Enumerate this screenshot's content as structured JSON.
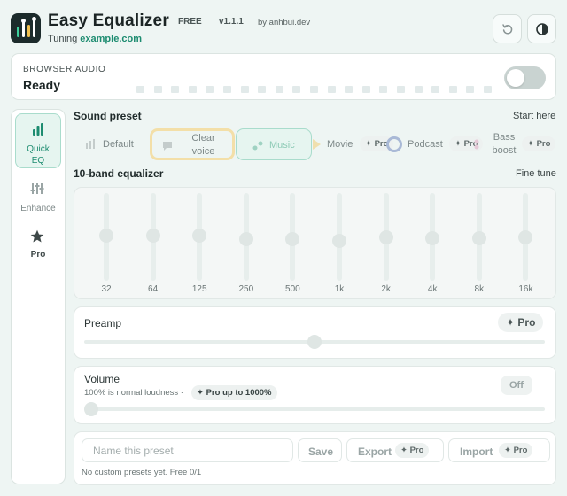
{
  "header": {
    "title": "Easy Equalizer",
    "badge": "FREE",
    "version": "v1.1.1",
    "author": "by anhbui.dev",
    "tuning_label": "Tuning",
    "tuning_domain": "example.com",
    "reset_icon": "reset-icon",
    "theme_icon": "contrast-icon"
  },
  "status": {
    "eyebrow": "BROWSER AUDIO",
    "value": "Ready",
    "enabled": false,
    "meter_level": 0
  },
  "sidebar": {
    "items": [
      {
        "label_line1": "Quick",
        "label_line2": "EQ",
        "icon": "bar-chart-icon",
        "active": true
      },
      {
        "label_line1": "Enhance",
        "label_line2": "",
        "icon": "sliders-icon",
        "active": false
      },
      {
        "label_line1": "Pro",
        "label_line2": "",
        "icon": "star-icon",
        "active": false
      }
    ]
  },
  "presets": {
    "title": "Sound preset",
    "link": "Start here",
    "items": [
      {
        "label": "Default",
        "icon": "bars-icon",
        "pro": ""
      },
      {
        "label_line1": "Clear",
        "label_line2": "voice",
        "icon": "speech-icon",
        "pro": "",
        "highlighted": true
      },
      {
        "label": "Music",
        "icon": "music-note-icon",
        "pro": "",
        "selected": true
      },
      {
        "label": "Movie",
        "icon": "play-icon",
        "pro": "✦ Pro"
      },
      {
        "label": "Podcast",
        "icon": "podcast-icon",
        "pro": "✦ Pro"
      },
      {
        "label_line1": "Bass",
        "label_line2": "boost",
        "icon": "bass-icon",
        "pro": "✦ Pro"
      }
    ]
  },
  "equalizer": {
    "title": "10-band equalizer",
    "link": "Fine tune",
    "bands": [
      {
        "freq": "32",
        "level": 0.52
      },
      {
        "freq": "64",
        "level": 0.52
      },
      {
        "freq": "125",
        "level": 0.52
      },
      {
        "freq": "250",
        "level": 0.47
      },
      {
        "freq": "500",
        "level": 0.47
      },
      {
        "freq": "1k",
        "level": 0.45
      },
      {
        "freq": "2k",
        "level": 0.5
      },
      {
        "freq": "4k",
        "level": 0.48
      },
      {
        "freq": "8k",
        "level": 0.48
      },
      {
        "freq": "16k",
        "level": 0.5
      }
    ]
  },
  "preamp": {
    "title": "Preamp",
    "pro": "✦ Pro",
    "level": 0.5
  },
  "volume": {
    "title": "Volume",
    "subtitle": "100% is normal loudness ·",
    "pro": "✦ Pro up to 1000%",
    "toggle_label": "Off",
    "level": 0
  },
  "custom_presets": {
    "input_placeholder": "Name this preset",
    "save_label": "Save",
    "export_label": "Export",
    "export_pro": "✦ Pro",
    "import_label": "Import",
    "import_pro": "✦ Pro",
    "empty_note": "No custom presets yet. Free 0/1"
  },
  "colors": {
    "accent": "#1d8c70",
    "highlight_border": "#f3dfa8",
    "selected_bg": "#e6f5f0"
  }
}
